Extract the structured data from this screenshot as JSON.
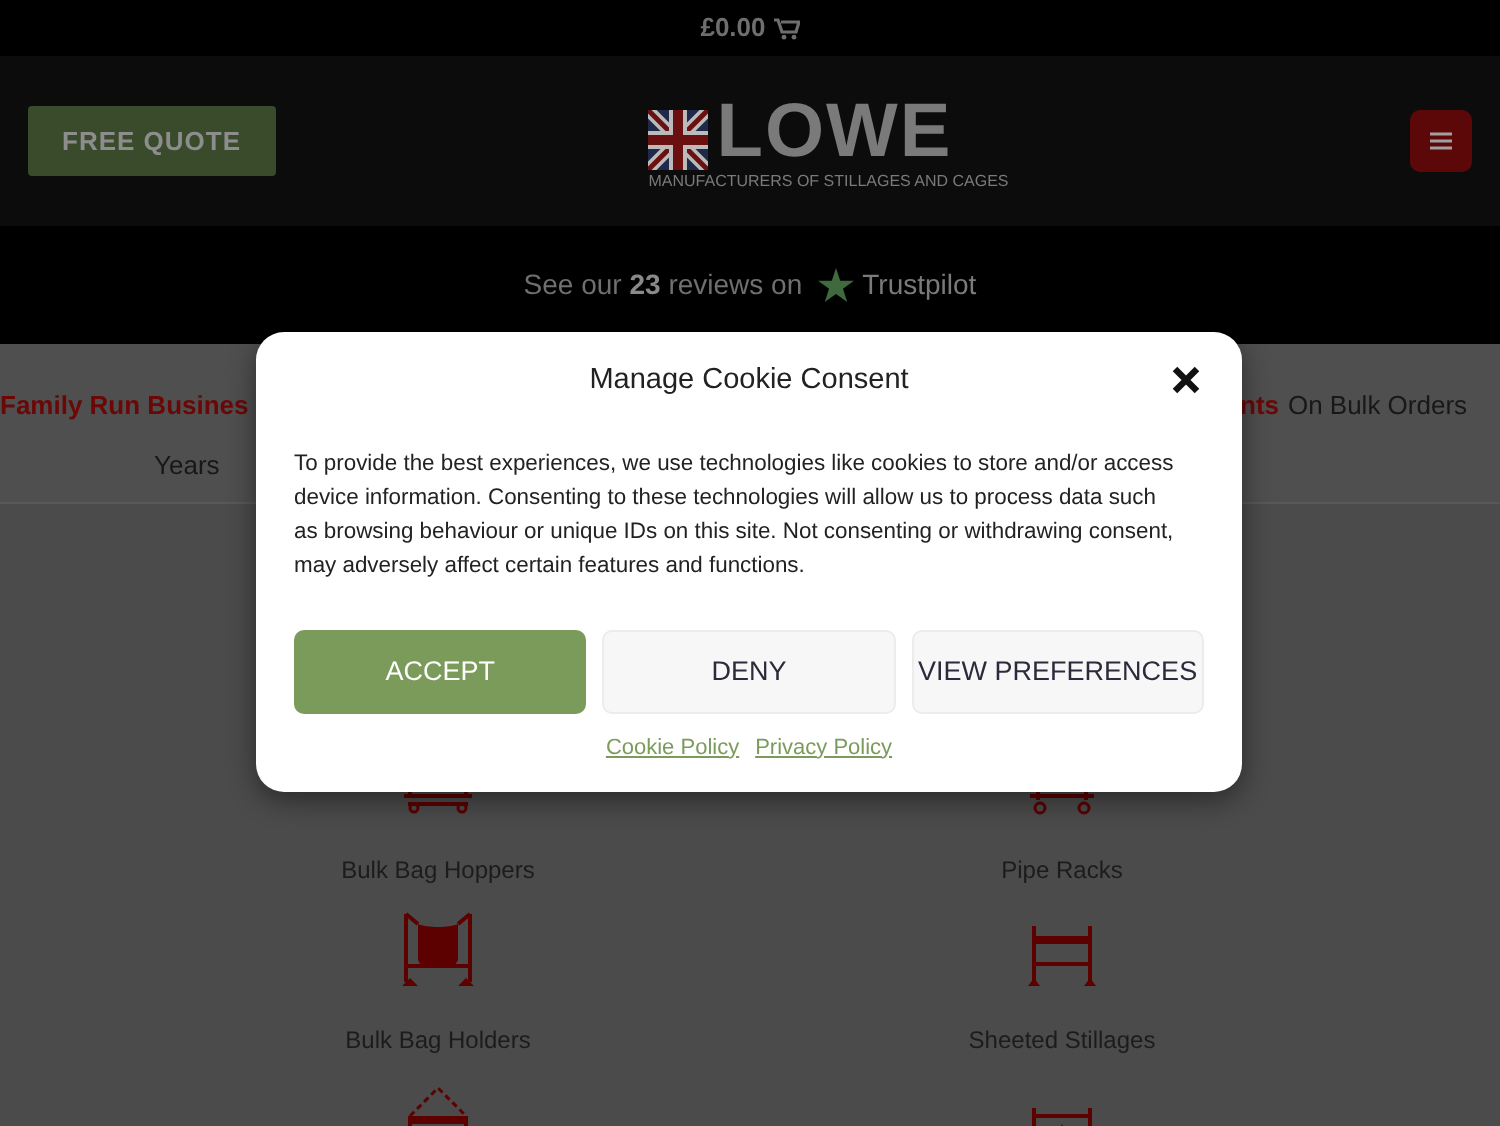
{
  "top_bar": {
    "cart_total": "£0.00"
  },
  "header": {
    "quote_button": "FREE QUOTE",
    "logo": {
      "wordmark": "LOWE",
      "tagline": "MANUFACTURERS OF STILLAGES AND CAGES"
    }
  },
  "reviews": {
    "text": "See our **23** reviews on",
    "brand": "Trustpilot"
  },
  "usps": [
    {
      "highlight": "Family Run Busines",
      "text": "Years"
    },
    {
      "highlight": "nts",
      "text": "On Bulk Orders"
    }
  ],
  "products": [
    {
      "kind": "hopper",
      "label": "Bulk Bag Hoppers"
    },
    {
      "kind": "rack",
      "label": "Pipe Racks"
    },
    {
      "kind": "holder",
      "label": "Bulk Bag Holders"
    },
    {
      "kind": "stillage",
      "label": "Sheeted Stillages"
    },
    {
      "kind": "lifting"
    },
    {
      "kind": "frame"
    }
  ],
  "cookie_dialog": {
    "title": "Manage Cookie Consent",
    "text": "To provide the best experiences, we use technologies like cookies to store and/or access device information. Consenting to these technologies will allow us to process data such as browsing behaviour or unique IDs on this site. Not consenting or withdrawing consent, may adversely affect certain features and functions.",
    "buttons": [
      {
        "label": "ACCEPT",
        "kind": "primary"
      },
      {
        "label": "DENY",
        "kind": "secondary"
      },
      {
        "label": "VIEW PREFERENCES",
        "kind": "secondary"
      }
    ],
    "links": [
      "Cookie Policy",
      "Privacy Policy"
    ]
  }
}
